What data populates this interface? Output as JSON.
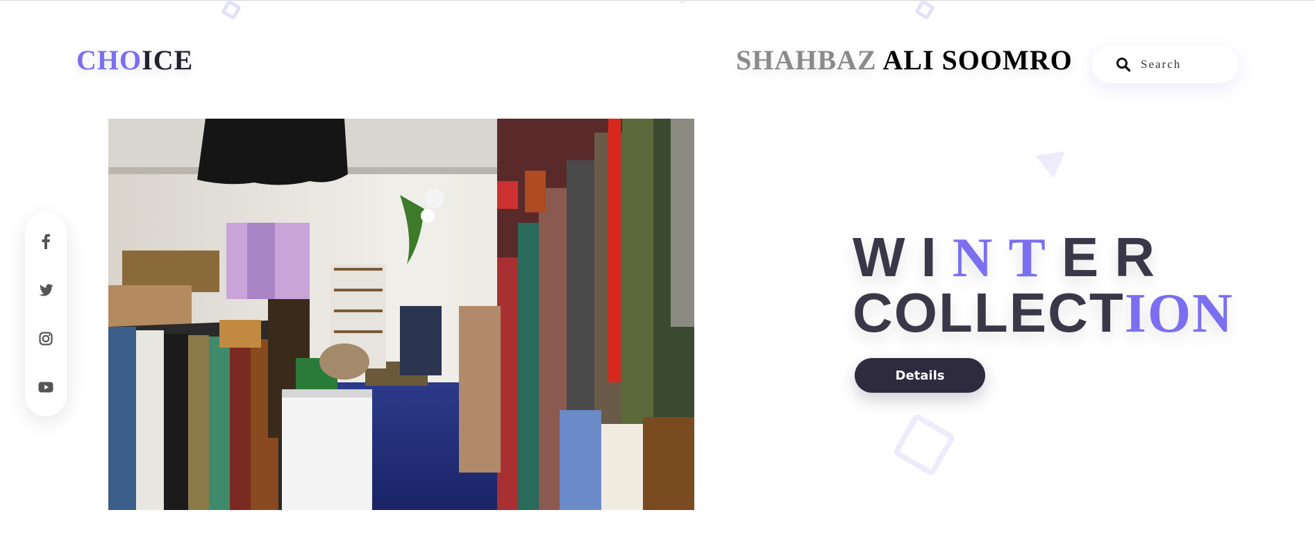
{
  "header": {
    "logo_accent": "CHO",
    "logo_rest": "ICE",
    "author_first": "SHAHBAZ",
    "author_rest": " ALI SOOMRO",
    "search": {
      "placeholder": "Search",
      "icon": "search-icon"
    }
  },
  "hero": {
    "title_line1": [
      {
        "text": "W",
        "highlight": false
      },
      {
        "text": "I",
        "highlight": false
      },
      {
        "text": "N",
        "highlight": true
      },
      {
        "text": "T",
        "highlight": true
      },
      {
        "text": "E",
        "highlight": false
      },
      {
        "text": "R",
        "highlight": false
      }
    ],
    "title_line2_plain": "COLLECT",
    "title_line2_highlight": "ION",
    "button_label": "Details",
    "image_alt": "clothing-store"
  },
  "social": [
    {
      "name": "facebook-icon"
    },
    {
      "name": "twitter-icon"
    },
    {
      "name": "instagram-icon"
    },
    {
      "name": "youtube-icon"
    }
  ],
  "colors": {
    "accent": "#7b6ff1",
    "dark": "#2e2b3e",
    "title_text": "#3a3848"
  }
}
